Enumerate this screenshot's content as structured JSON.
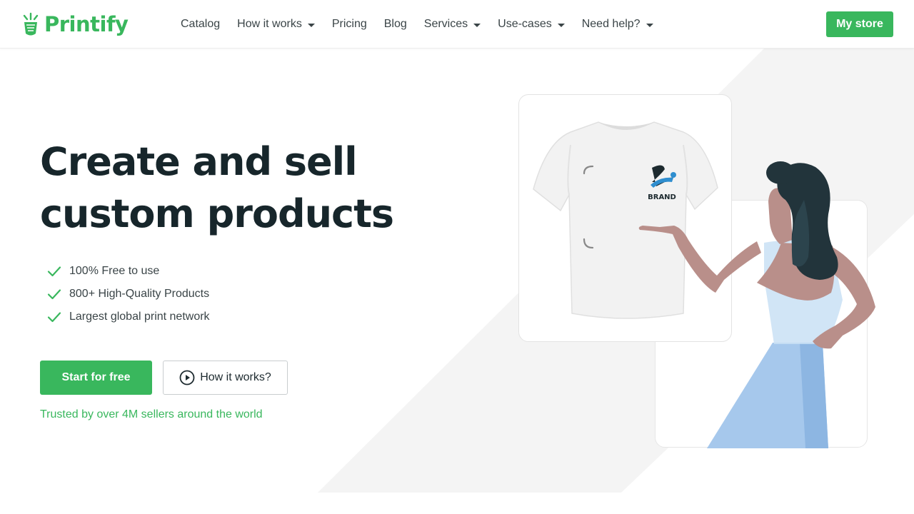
{
  "header": {
    "brand": "Printify",
    "nav": [
      {
        "label": "Catalog",
        "has_dropdown": false
      },
      {
        "label": "How it works",
        "has_dropdown": true
      },
      {
        "label": "Pricing",
        "has_dropdown": false
      },
      {
        "label": "Blog",
        "has_dropdown": false
      },
      {
        "label": "Services",
        "has_dropdown": true
      },
      {
        "label": "Use-cases",
        "has_dropdown": true
      },
      {
        "label": "Need help?",
        "has_dropdown": true
      }
    ],
    "cta_label": "My store"
  },
  "hero": {
    "title_line1": "Create and sell",
    "title_line2": "custom products",
    "features": [
      "100% Free to use",
      "800+ High-Quality Products",
      "Largest global print network"
    ],
    "primary_cta": "Start for free",
    "secondary_cta": "How it works?",
    "trusted_text": "Trusted by over 4M sellers around the world"
  },
  "illustration": {
    "brand_label": "BRAND"
  },
  "colors": {
    "brand_green": "#39b75d",
    "heading": "#17262b",
    "text": "#3a4447",
    "band": "#f4f4f4"
  },
  "icons": [
    "logo-icon",
    "chevron-down-icon",
    "check-icon",
    "play-circle-icon"
  ]
}
